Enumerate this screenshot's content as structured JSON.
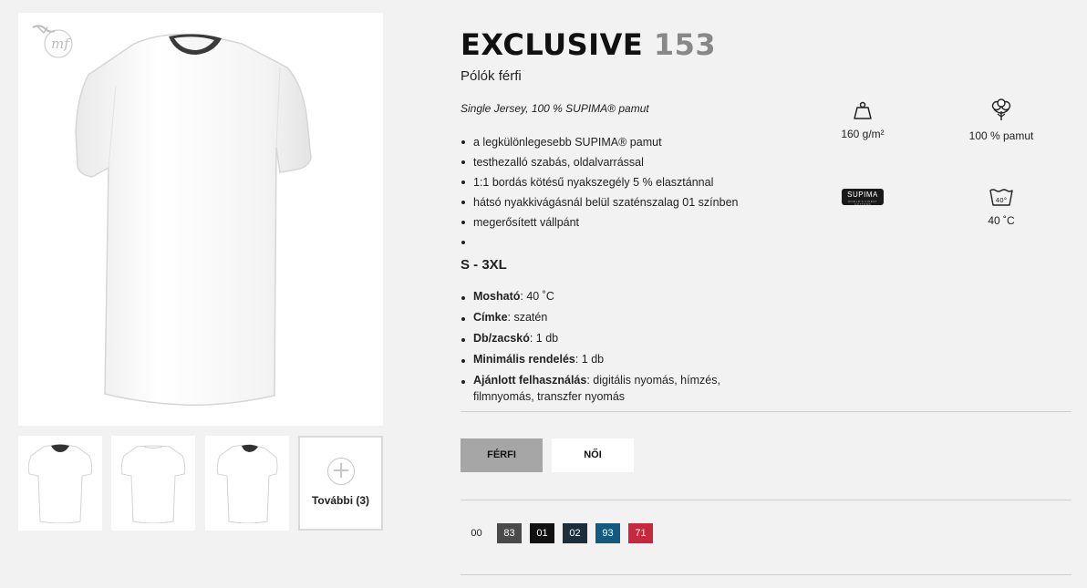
{
  "product": {
    "title_name": "EXCLUSIVE",
    "title_number": "153",
    "subtitle": "Pólók férfi",
    "material": "Single Jersey, 100 % SUPIMA® pamut",
    "features": [
      "a legkülönlegesebb SUPIMA® pamut",
      "testhezalló szabás, oldalvarrással",
      "1:1 bordás kötésű nyakszegély 5 % elasztánnal",
      "hátsó nyakkivágásnál belül szaténszalag 01 színben",
      "megerősített vállpánt",
      ""
    ],
    "sizes": "S - 3XL",
    "specs": [
      {
        "label": "Mosható",
        "value": ": 40 ˚C"
      },
      {
        "label": "Címke",
        "value": ": szatén"
      },
      {
        "label": "Db/zacskó",
        "value": ": 1 db"
      },
      {
        "label": "Minimális rendelés",
        "value": ": 1 db"
      },
      {
        "label": "Ajánlott felhasználás",
        "value": ": digitális nyomás, hímzés, filmnyomás, transzfer nyomás"
      }
    ]
  },
  "icons": {
    "weight": {
      "icon": "weight-icon",
      "label": "160 g/m²"
    },
    "cotton": {
      "icon": "cotton-flower-icon",
      "label": "100 % pamut"
    },
    "supima": {
      "icon": "supima-logo",
      "text": "SUPIMA",
      "subtext": "WORLD'S FINEST COTTONS"
    },
    "wash": {
      "icon": "wash-40-icon",
      "symbol": "40°",
      "label": "40 ˚C"
    }
  },
  "gallery": {
    "more_label": "További (3)",
    "logo_text": "mf"
  },
  "gender": {
    "male": "FÉRFI",
    "female": "NŐI"
  },
  "colors": [
    {
      "code": "00",
      "bg": "#f2f2f2",
      "fg": "#222222"
    },
    {
      "code": "83",
      "bg": "#4a4a4a",
      "fg": "#ffffff"
    },
    {
      "code": "01",
      "bg": "#111111",
      "fg": "#ffffff"
    },
    {
      "code": "02",
      "bg": "#1c2d3b",
      "fg": "#ffffff"
    },
    {
      "code": "93",
      "bg": "#145a80",
      "fg": "#ffffff"
    },
    {
      "code": "71",
      "bg": "#c8283e",
      "fg": "#ffffff"
    }
  ]
}
